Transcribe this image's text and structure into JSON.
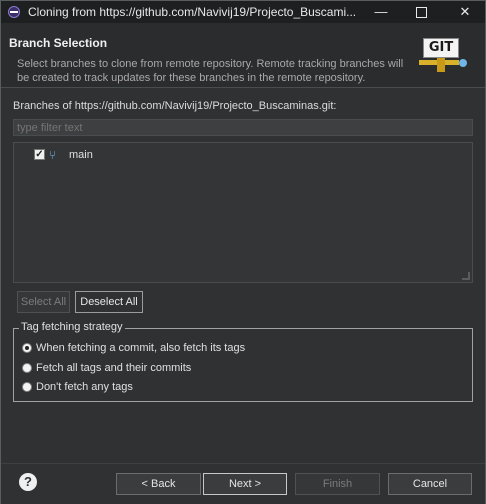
{
  "window": {
    "title": "Cloning from https://github.com/Navivij19/Projecto_Buscami...",
    "controls": {
      "minimize": "—",
      "maximize": "",
      "close": "✕"
    }
  },
  "header": {
    "title": "Branch Selection",
    "description": "Select branches to clone from remote repository. Remote tracking branches will be created to track updates for these branches in the remote repository.",
    "logo_text": "GIT"
  },
  "branches": {
    "label": "Branches of https://github.com/Navivij19/Projecto_Buscaminas.git:",
    "filter_placeholder": "type filter text",
    "items": [
      {
        "name": "main",
        "checked": true,
        "icon": "branch-icon"
      }
    ]
  },
  "buttons": {
    "select_all": "Select All",
    "deselect_all": "Deselect All",
    "back": "< Back",
    "next": "Next >",
    "finish": "Finish",
    "cancel": "Cancel",
    "help": "?"
  },
  "tag_strategy": {
    "title": "Tag fetching strategy",
    "options": [
      {
        "label": "When fetching a commit, also fetch its tags",
        "selected": true
      },
      {
        "label": "Fetch all tags and their commits",
        "selected": false
      },
      {
        "label": "Don't fetch any tags",
        "selected": false
      }
    ]
  },
  "colors": {
    "background": "#2f3133",
    "titlebar": "#1e1f21",
    "accent_branch": "#6fb6e8"
  }
}
